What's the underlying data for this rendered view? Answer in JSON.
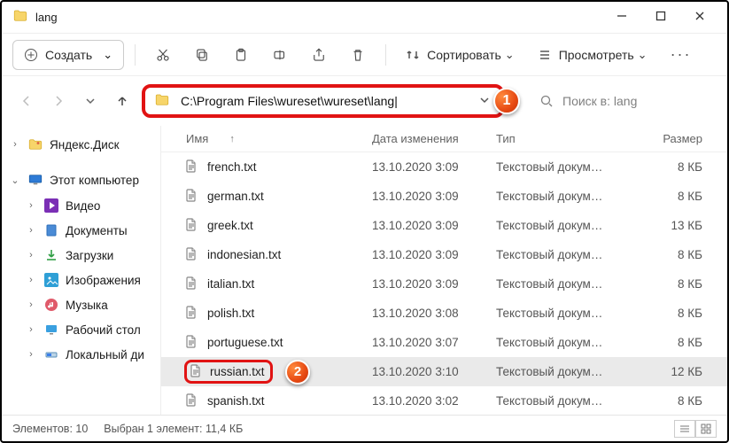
{
  "window": {
    "title": "lang"
  },
  "toolbar": {
    "create_label": "Создать",
    "sort_label": "Сортировать",
    "view_label": "Просмотреть"
  },
  "nav": {
    "path": "C:\\Program Files\\wureset\\wureset\\lang|",
    "search_placeholder": "Поиск в: lang"
  },
  "callouts": {
    "one": "1",
    "two": "2"
  },
  "sidebar": {
    "yandex": "Яндекс.Диск",
    "this_pc": "Этот компьютер",
    "video": "Видео",
    "documents": "Документы",
    "downloads": "Загрузки",
    "pictures": "Изображения",
    "music": "Музыка",
    "desktop": "Рабочий стол",
    "local_disk": "Локальный ди"
  },
  "columns": {
    "name": "Имя",
    "date": "Дата изменения",
    "type": "Тип",
    "size": "Размер"
  },
  "files": [
    {
      "name": "french.txt",
      "date": "13.10.2020 3:09",
      "type": "Текстовый докум…",
      "size": "8 КБ"
    },
    {
      "name": "german.txt",
      "date": "13.10.2020 3:09",
      "type": "Текстовый докум…",
      "size": "8 КБ"
    },
    {
      "name": "greek.txt",
      "date": "13.10.2020 3:09",
      "type": "Текстовый докум…",
      "size": "13 КБ"
    },
    {
      "name": "indonesian.txt",
      "date": "13.10.2020 3:09",
      "type": "Текстовый докум…",
      "size": "8 КБ"
    },
    {
      "name": "italian.txt",
      "date": "13.10.2020 3:09",
      "type": "Текстовый докум…",
      "size": "8 КБ"
    },
    {
      "name": "polish.txt",
      "date": "13.10.2020 3:08",
      "type": "Текстовый докум…",
      "size": "8 КБ"
    },
    {
      "name": "portuguese.txt",
      "date": "13.10.2020 3:07",
      "type": "Текстовый докум…",
      "size": "8 КБ"
    },
    {
      "name": "russian.txt",
      "date": "13.10.2020 3:10",
      "type": "Текстовый докум…",
      "size": "12 КБ",
      "selected": true,
      "highlighted": true
    },
    {
      "name": "spanish.txt",
      "date": "13.10.2020 3:02",
      "type": "Текстовый докум…",
      "size": "8 КБ"
    }
  ],
  "status": {
    "count": "Элементов: 10",
    "selection": "Выбран 1 элемент: 11,4 КБ"
  },
  "icons": {
    "chevron_down": "⌄",
    "sort_arrow": "↑"
  }
}
